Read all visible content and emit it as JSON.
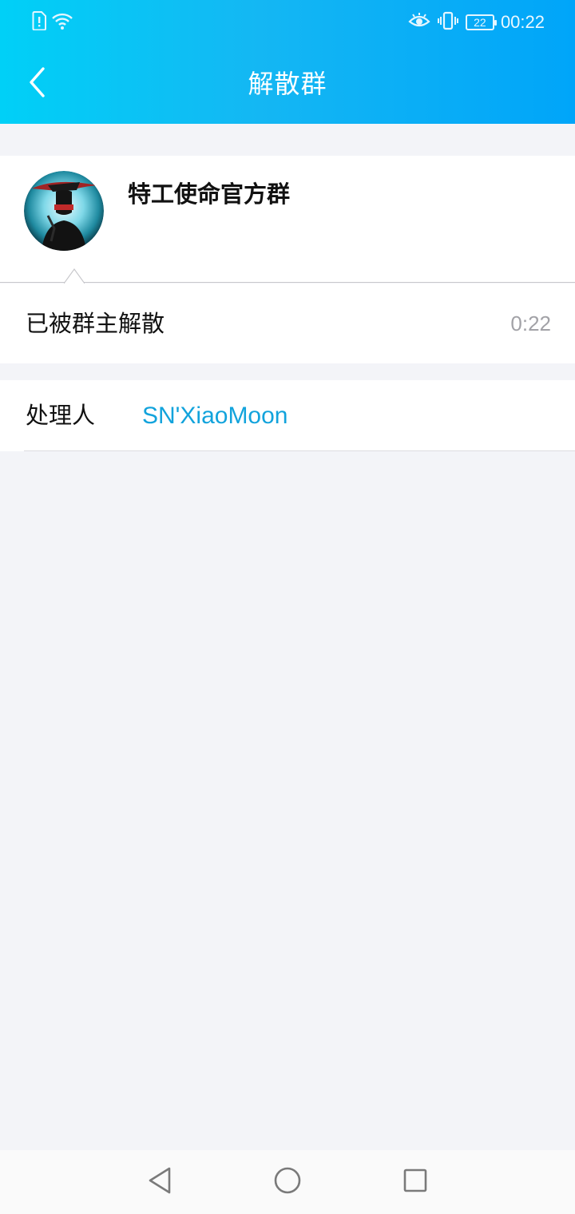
{
  "status_bar": {
    "time": "00:22",
    "battery_level": "22",
    "icons": [
      "sim-alert-icon",
      "wifi-icon",
      "eye-icon",
      "vibrate-icon",
      "battery-icon"
    ]
  },
  "header": {
    "title": "解散群",
    "back_icon": "chevron-left-icon"
  },
  "group": {
    "name": "特工使命官方群",
    "avatar": "group-avatar"
  },
  "notice": {
    "text": "已被群主解散",
    "time": "0:22"
  },
  "handler": {
    "label": "处理人",
    "name": "SN'XiaoMoon"
  },
  "nav_bar": {
    "buttons": [
      "back-triangle-icon",
      "home-circle-icon",
      "recents-square-icon"
    ]
  },
  "colors": {
    "header_gradient_start": "#00d0f7",
    "header_gradient_end": "#00a5f9",
    "link": "#12a3dc",
    "background": "#f3f4f8"
  }
}
